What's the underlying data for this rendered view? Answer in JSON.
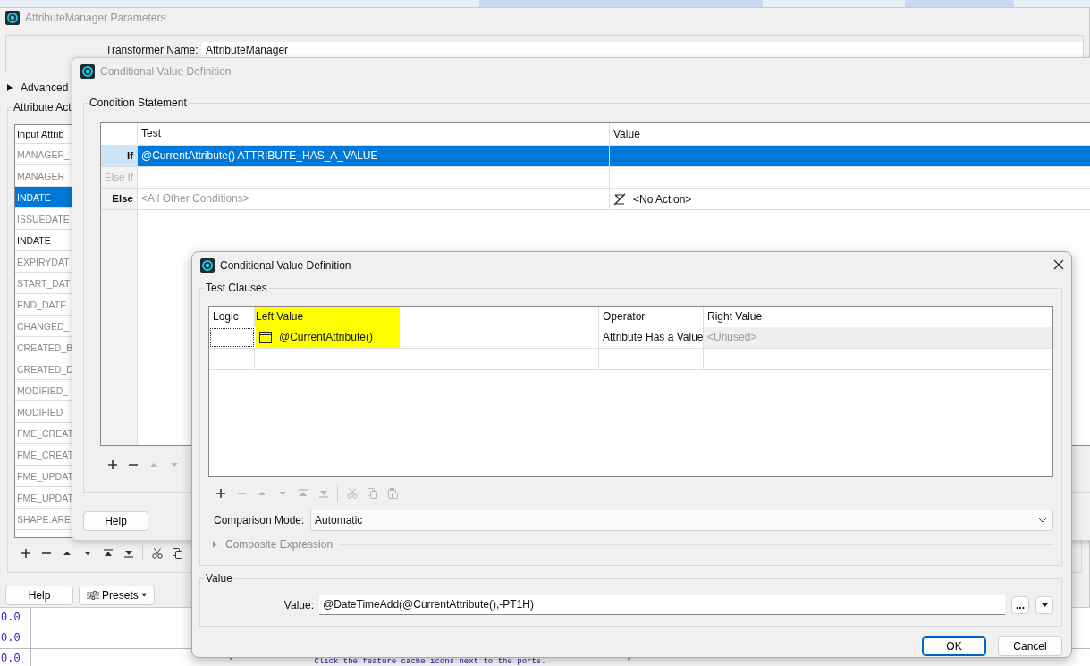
{
  "background": {
    "log_values": [
      "0.0",
      "0.0",
      "0.0"
    ],
    "console_line": {
      "left_mark": "*",
      "text": "Click the feature cache icons next to the ports.",
      "right_mark": "*"
    }
  },
  "parameters_window": {
    "title": "AttributeManager Parameters",
    "active": false,
    "transformer_name_label": "Transformer Name:",
    "transformer_name": "AttributeManager",
    "advanced": {
      "label": "Advanced",
      "expanded": false
    },
    "group_title": "Attribute Act",
    "table": {
      "header": "Input Attrib",
      "rows": [
        {
          "text": "MANAGER_",
          "selected": false,
          "dimmed": true
        },
        {
          "text": "MANAGER_",
          "selected": false,
          "dimmed": true
        },
        {
          "text": "INDATE",
          "selected": true,
          "dimmed": false
        },
        {
          "text": "ISSUEDATE",
          "selected": false,
          "dimmed": true
        },
        {
          "text": "INDATE",
          "selected": false,
          "dimmed": false
        },
        {
          "text": "EXPIRYDAT",
          "selected": false,
          "dimmed": true
        },
        {
          "text": "START_DAT",
          "selected": false,
          "dimmed": true
        },
        {
          "text": "END_DATE",
          "selected": false,
          "dimmed": true
        },
        {
          "text": "CHANGED_",
          "selected": false,
          "dimmed": true
        },
        {
          "text": "CREATED_B",
          "selected": false,
          "dimmed": true
        },
        {
          "text": "CREATED_D",
          "selected": false,
          "dimmed": true
        },
        {
          "text": "MODIFIED_",
          "selected": false,
          "dimmed": true
        },
        {
          "text": "MODIFIED_",
          "selected": false,
          "dimmed": true
        },
        {
          "text": "FME_CREAT",
          "selected": false,
          "dimmed": true
        },
        {
          "text": "FME_CREAT",
          "selected": false,
          "dimmed": true
        },
        {
          "text": "FME_UPDAT",
          "selected": false,
          "dimmed": true
        },
        {
          "text": "FME_UPDAT",
          "selected": false,
          "dimmed": true
        },
        {
          "text": "SHAPE.ARE",
          "selected": false,
          "dimmed": true
        }
      ]
    },
    "toolbar": [
      {
        "kind": "add",
        "disabled": false
      },
      {
        "kind": "remove",
        "disabled": false
      },
      {
        "kind": "up",
        "disabled": false
      },
      {
        "kind": "down",
        "disabled": false
      },
      {
        "kind": "top",
        "disabled": false
      },
      {
        "kind": "bottom",
        "disabled": false
      },
      {
        "kind": "cut",
        "disabled": false
      },
      {
        "kind": "copy",
        "disabled": false
      }
    ],
    "buttons": [
      {
        "kind": "help",
        "label": "Help"
      },
      {
        "kind": "presets",
        "label": "Presets"
      }
    ]
  },
  "condition_window": {
    "title": "Conditional Value Definition",
    "active": false,
    "group_title": "Condition Statement",
    "columns": [
      "Test",
      "Value"
    ],
    "rows": [
      {
        "label": "If",
        "label_disabled": false,
        "test": "@CurrentAttribute() ATTRIBUTE_HAS_A_VALUE",
        "test_greyed": false,
        "selected": true
      },
      {
        "label": "Else If",
        "label_disabled": true,
        "selected": false
      },
      {
        "label": "Else",
        "label_disabled": false,
        "test": "<All Other Conditions>",
        "test_greyed": true,
        "value": "<No Action>",
        "no_action_icon": true,
        "selected": false
      }
    ],
    "toolbar": [
      {
        "kind": "add",
        "disabled": false
      },
      {
        "kind": "remove",
        "disabled": false
      },
      {
        "kind": "up",
        "disabled": true
      },
      {
        "kind": "down",
        "disabled": true
      }
    ],
    "help_label": "Help"
  },
  "clause_window": {
    "title": "Conditional Value Definition",
    "active": true,
    "group_title": "Test Clauses",
    "columns": [
      {
        "label": "Logic",
        "highlighted": false
      },
      {
        "label": "Left Value",
        "highlighted": true
      },
      {
        "label": "Operator",
        "highlighted": false
      },
      {
        "label": "Right Value",
        "highlighted": false
      }
    ],
    "rows": [
      {
        "logic_focused": true,
        "left_value": "@CurrentAttribute()",
        "left_highlighted": true,
        "operator": "Attribute Has a Value",
        "right_value": "<Unused>",
        "right_unused": true
      }
    ],
    "toolbar": [
      {
        "kind": "add",
        "disabled": false
      },
      {
        "kind": "remove",
        "disabled": true
      },
      {
        "kind": "up",
        "disabled": true
      },
      {
        "kind": "down",
        "disabled": true
      },
      {
        "kind": "top",
        "disabled": true
      },
      {
        "kind": "bottom",
        "disabled": true
      },
      {
        "kind": "cut",
        "disabled": true
      },
      {
        "kind": "copy",
        "disabled": true
      },
      {
        "kind": "paste",
        "disabled": true
      }
    ],
    "comparison_mode": {
      "label": "Comparison Mode:",
      "value": "Automatic"
    },
    "composite_expression": {
      "label": "Composite Expression",
      "expanded": false,
      "disabled": true
    },
    "value_group": {
      "title": "Value",
      "label": "Value:",
      "value": "@DateTimeAdd(@CurrentAttribute(),-PT1H)",
      "browse_label": "..."
    },
    "buttons": [
      {
        "label": "OK",
        "default": true
      },
      {
        "label": "Cancel",
        "default": false
      }
    ]
  }
}
